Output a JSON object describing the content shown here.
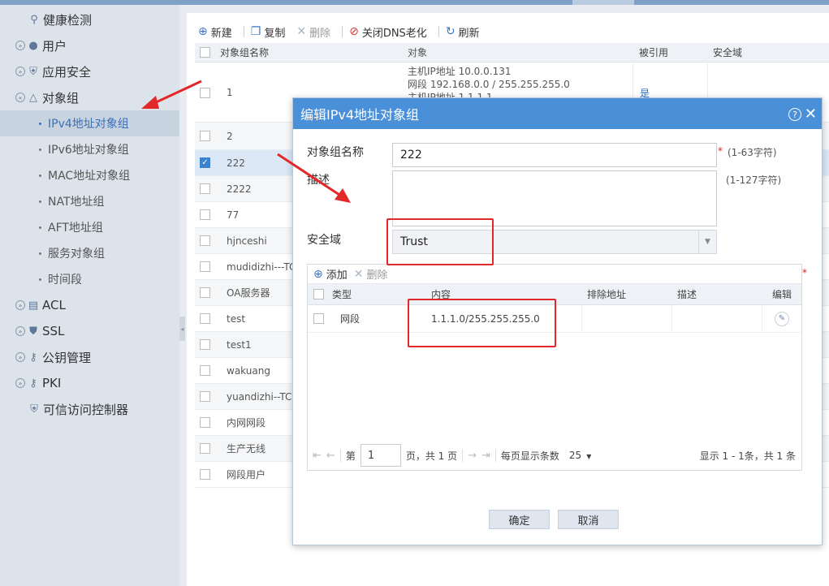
{
  "sidebar": {
    "items": [
      {
        "label": "健康检测",
        "icon": "pulse-icon",
        "expandable": false
      },
      {
        "label": "用户",
        "icon": "user-icon",
        "expandable": true
      },
      {
        "label": "应用安全",
        "icon": "shield-icon",
        "expandable": true
      },
      {
        "label": "对象组",
        "icon": "triangle-group-icon",
        "expandable": true
      }
    ],
    "sub_items": [
      {
        "label": "IPv4地址对象组",
        "active": true
      },
      {
        "label": "IPv6地址对象组"
      },
      {
        "label": "MAC地址对象组"
      },
      {
        "label": "NAT地址组"
      },
      {
        "label": "AFT地址组"
      },
      {
        "label": "服务对象组"
      },
      {
        "label": "时间段"
      }
    ],
    "bottom_items": [
      {
        "label": "ACL",
        "icon": "acl-icon"
      },
      {
        "label": "SSL",
        "icon": "ssl-shield-icon"
      },
      {
        "label": "公钥管理",
        "icon": "key-icon"
      },
      {
        "label": "PKI",
        "icon": "pki-key-icon"
      },
      {
        "label": "可信访问控制器",
        "icon": "shield-icon"
      }
    ]
  },
  "toolbar": {
    "new": "新建",
    "copy": "复制",
    "delete": "删除",
    "close_dns": "关闭DNS老化",
    "refresh": "刷新"
  },
  "grid": {
    "headers": {
      "name": "对象组名称",
      "object": "对象",
      "ref": "被引用",
      "zone": "安全域"
    },
    "rows": [
      {
        "name": "1",
        "objects": [
          "主机IP地址 10.0.0.131",
          "网段 192.168.0.0 / 255.255.255.0",
          "主机IP地址 1.1.1.1"
        ],
        "ref": "是"
      },
      {
        "name": "2"
      },
      {
        "name": "222",
        "checked": true
      },
      {
        "name": "2222"
      },
      {
        "name": "77"
      },
      {
        "name": "hjnceshi"
      },
      {
        "name": "mudidizhi---TC"
      },
      {
        "name": "OA服务器"
      },
      {
        "name": "test"
      },
      {
        "name": "test1"
      },
      {
        "name": "wakuang"
      },
      {
        "name": "yuandizhi--TC"
      },
      {
        "name": "内网网段"
      },
      {
        "name": "生产无线"
      },
      {
        "name": "网段用户"
      }
    ]
  },
  "dialog": {
    "title": "编辑IPv4地址对象组",
    "name_label": "对象组名称",
    "name_value": "222",
    "name_hint": "(1-63字符)",
    "desc_label": "描述",
    "desc_value": "",
    "desc_hint": "(1-127字符)",
    "zone_label": "安全域",
    "zone_value": "Trust",
    "required_mark": "*",
    "sub_toolbar": {
      "add": "添加",
      "delete": "删除"
    },
    "sub_headers": {
      "type": "类型",
      "content": "内容",
      "exclude": "排除地址",
      "desc": "描述",
      "edit": "编辑"
    },
    "sub_rows": [
      {
        "type": "网段",
        "content": "1.1.1.0/255.255.255.0",
        "exclude": "",
        "desc": ""
      }
    ],
    "pager": {
      "page_prefix": "第",
      "page_value": "1",
      "page_suffix": "页，共 1 页",
      "per_page_label": "每页显示条数",
      "per_page_value": "25",
      "summary": "显示 1 - 1条，共 1 条"
    },
    "ok": "确定",
    "cancel": "取消"
  },
  "colors": {
    "dialog_title_bg": "#4a90d9",
    "annotation_red": "#e3282a",
    "active_link": "#3a6fb8"
  }
}
